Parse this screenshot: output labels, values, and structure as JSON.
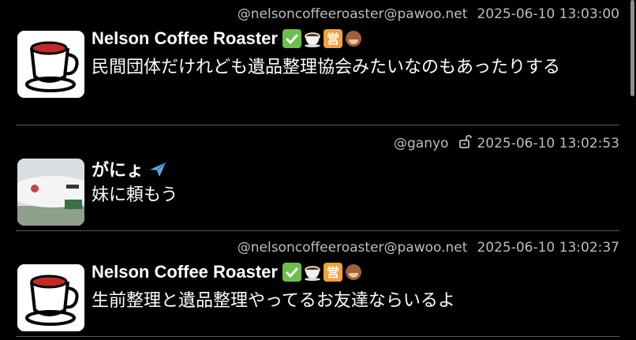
{
  "posts": [
    {
      "handle": "@nelsoncoffeeroaster@pawoo.net",
      "time": "2025-06-10 13:03:00",
      "name": "Nelson Coffee Roaster",
      "name_emojis": [
        "check-mark-icon",
        "coffee-cup-icon",
        "business-badge-icon",
        "monkey-icon"
      ],
      "body": "民間団体だけれども遺品整理協会みたいなのもあったりする",
      "locked": false
    },
    {
      "handle": "@ganyo",
      "time": "2025-06-10 13:02:53",
      "name": "がにょ",
      "name_emojis": [
        "airplane-icon"
      ],
      "body": "妹に頼もう",
      "locked": true
    },
    {
      "handle": "@nelsoncoffeeroaster@pawoo.net",
      "time": "2025-06-10 13:02:37",
      "name": "Nelson Coffee Roaster",
      "name_emojis": [
        "check-mark-icon",
        "coffee-cup-icon",
        "business-badge-icon",
        "monkey-icon"
      ],
      "body": "生前整理と遺品整理やってるお友達ならいるよ",
      "locked": false
    }
  ],
  "badge_glyph": "営",
  "colors": {
    "background": "#000000",
    "meta_text": "#bdbdbd",
    "divider": "#5a5a5a",
    "check_green": "#6cc04a",
    "badge_orange": "#f4a23a"
  }
}
